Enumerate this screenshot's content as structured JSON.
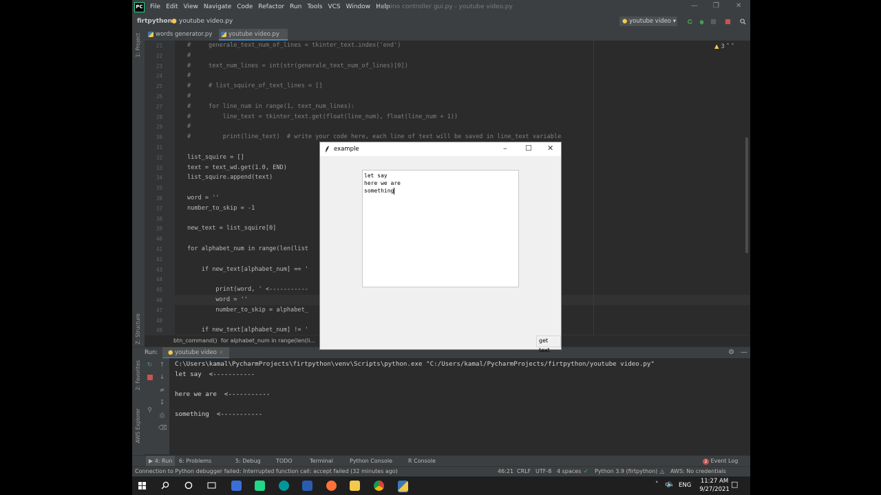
{
  "app": {
    "logo_text": "PC",
    "menu": [
      "File",
      "Edit",
      "View",
      "Navigate",
      "Code",
      "Refactor",
      "Run",
      "Tools",
      "VCS",
      "Window",
      "Help"
    ],
    "window_title": "arduino controller gui.py - youtube video.py"
  },
  "navbar": {
    "project": "firtpython",
    "file": "youtube video.py",
    "run_config": "youtube video"
  },
  "tabs": [
    {
      "label": "words generator.py",
      "active": false
    },
    {
      "label": "youtube video.py",
      "active": true
    }
  ],
  "left_strip": {
    "project": "1: Project",
    "structure": "Z: Structure",
    "favorites": "2: Favorites",
    "aws": "AWS Explorer"
  },
  "editor": {
    "warnings": "3",
    "current_line": "46"
  },
  "code_lines": [
    {
      "n": "21",
      "t": "#     generale_text_num_of_lines = tkinter_text.index('end')"
    },
    {
      "n": "22",
      "t": "#"
    },
    {
      "n": "23",
      "t": "#     text_num_lines = int(str(generale_text_num_of_lines)[0])"
    },
    {
      "n": "24",
      "t": "#"
    },
    {
      "n": "25",
      "t": "#     # list_squire_of_text_lines = []"
    },
    {
      "n": "26",
      "t": "#"
    },
    {
      "n": "27",
      "t": "#     for line_num in range(1, text_num_lines):"
    },
    {
      "n": "28",
      "t": "#         line_text = tkinter_text.get(float(line_num), float(line_num + 1))"
    },
    {
      "n": "29",
      "t": "#"
    },
    {
      "n": "30",
      "t": "#         print(line_text)  # write your code here, each line of text will be saved in line_text variable"
    },
    {
      "n": "31",
      "t": ""
    },
    {
      "n": "32",
      "t": "list_squire = []"
    },
    {
      "n": "33",
      "t": "text = text_wd.get(1.0, END)"
    },
    {
      "n": "34",
      "t": "list_squire.append(text)"
    },
    {
      "n": "35",
      "t": ""
    },
    {
      "n": "36",
      "t": "word = ''"
    },
    {
      "n": "37",
      "t": "number_to_skip = -1"
    },
    {
      "n": "38",
      "t": ""
    },
    {
      "n": "39",
      "t": "new_text = list_squire[0]"
    },
    {
      "n": "40",
      "t": ""
    },
    {
      "n": "41",
      "t": "for alphabet_num in range(len(list"
    },
    {
      "n": "42",
      "t": ""
    },
    {
      "n": "43",
      "t": "    if new_text[alphabet_num] == '"
    },
    {
      "n": "44",
      "t": ""
    },
    {
      "n": "45",
      "t": "        print(word, ' <-----------"
    },
    {
      "n": "46",
      "t": "        word = ''"
    },
    {
      "n": "47",
      "t": "        number_to_skip = alphabet_"
    },
    {
      "n": "48",
      "t": ""
    },
    {
      "n": "49",
      "t": "    if new_text[alphabet_num] != '"
    }
  ],
  "breadcrumb": [
    "btn_command()",
    "for alphabet_num in range(len(li..."
  ],
  "run_panel": {
    "label": "Run:",
    "tab": "youtube video",
    "output": [
      "C:\\Users\\kamal\\PycharmProjects\\firtpython\\venv\\Scripts\\python.exe \"C:/Users/kamal/PycharmProjects/firtpython/youtube video.py\"",
      "let say  <-----------",
      "",
      "here we are  <-----------",
      "",
      "something  <-----------"
    ]
  },
  "bottom_tabs": [
    "4: Run",
    "6: Problems",
    "5: Debug",
    "TODO",
    "Terminal",
    "Python Console",
    "R Console",
    "Event Log"
  ],
  "event_log_count": "2",
  "status": {
    "message": "Connection to Python debugger failed: Interrupted function call: accept failed (32 minutes ago)",
    "position": "46:21",
    "line_sep": "CRLF",
    "encoding": "UTF-8",
    "indent": "4 spaces",
    "interpreter": "Python 3.9 (firtpython)",
    "aws": "AWS: No credentials selected"
  },
  "tk_window": {
    "title": "example",
    "text_lines": [
      "let say",
      "here we are",
      "something"
    ],
    "button": "get text"
  },
  "taskbar": {
    "lang": "ENG",
    "time": "11:27 AM",
    "date": "9/27/2021"
  },
  "colors": {
    "ide_bg": "#2b2b2b",
    "panel_bg": "#3c3f41",
    "comment": "#808080",
    "keyword": "#cc7832",
    "number": "#6897bb",
    "string": "#6a8759",
    "stop_red": "#c75450",
    "run_green": "#499c54"
  }
}
